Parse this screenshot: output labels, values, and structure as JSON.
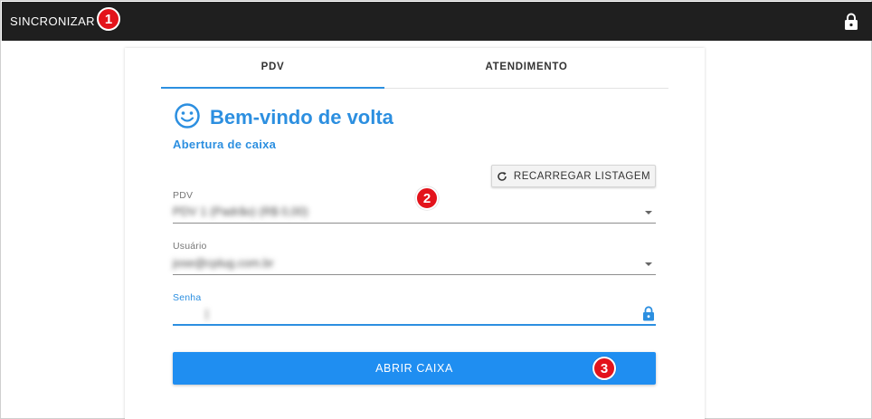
{
  "topbar": {
    "sync_label": "SINCRONIZAR",
    "lock_icon": "lock-icon"
  },
  "tabs": [
    {
      "label": "PDV",
      "active": true
    },
    {
      "label": "ATENDIMENTO",
      "active": false
    }
  ],
  "welcome": {
    "icon": "smiley-icon",
    "title": "Bem-vindo de volta",
    "subtitle": "Abertura de caixa"
  },
  "reload_button": {
    "icon": "refresh-icon",
    "label": "RECARREGAR LISTAGEM"
  },
  "form": {
    "pdv": {
      "label": "PDV",
      "value": "PDV 1 (Padrão) (R$ 0,00)"
    },
    "usuario": {
      "label": "Usuário",
      "value": "jose@cplug.com.br"
    },
    "senha": {
      "label": "Senha",
      "value": "|"
    }
  },
  "open_button": {
    "label": "ABRIR CAIXA"
  },
  "markers": [
    "1",
    "2",
    "3"
  ],
  "colors": {
    "accent": "#2c8fe0",
    "button": "#1f8ef1",
    "topbar": "#1f1f1f",
    "marker": "#e3131b"
  }
}
